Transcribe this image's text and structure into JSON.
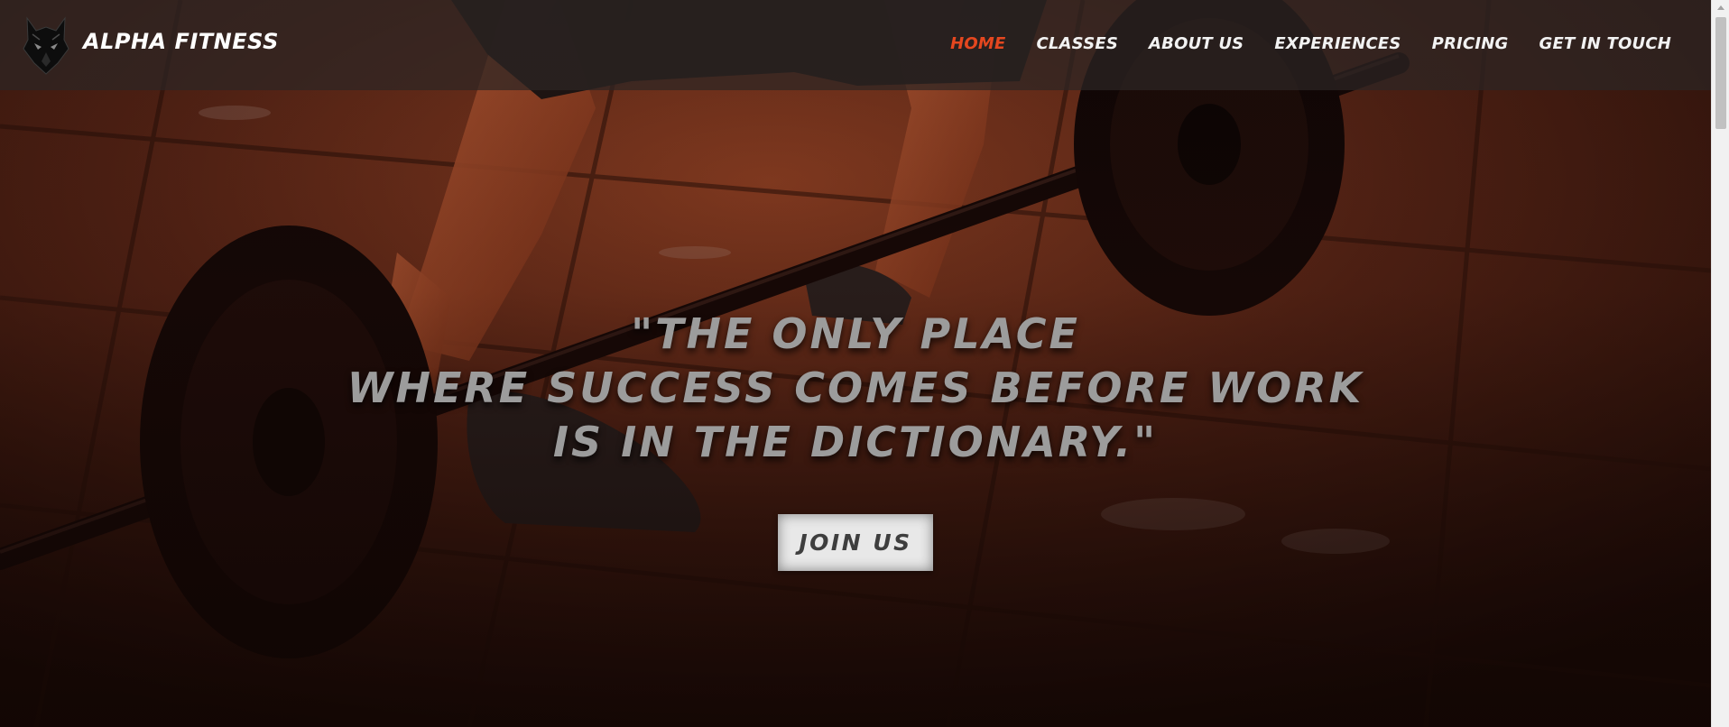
{
  "brand": {
    "name": "ALPHA FITNESS",
    "logo_icon": "wolf-head-icon"
  },
  "nav": {
    "items": [
      {
        "label": "HOME",
        "active": true
      },
      {
        "label": "CLASSES",
        "active": false
      },
      {
        "label": "ABOUT US",
        "active": false
      },
      {
        "label": "EXPERIENCES",
        "active": false
      },
      {
        "label": "PRICING",
        "active": false
      },
      {
        "label": "GET IN TOUCH",
        "active": false
      }
    ]
  },
  "hero": {
    "quote_lines": [
      "\"THE ONLY PLACE",
      "WHERE SUCCESS COMES BEFORE WORK",
      "IS IN THE DICTIONARY.\""
    ],
    "cta_label": "JOIN US",
    "background_icon": "barbell-deadlift-photo"
  },
  "colors": {
    "accent": "#e5471f",
    "nav_text": "#f2f2f2",
    "quote_text": "#9c9c9c",
    "navbar_bg": "rgba(45,38,36,0.72)",
    "button_bg": "#e8e8e8"
  }
}
